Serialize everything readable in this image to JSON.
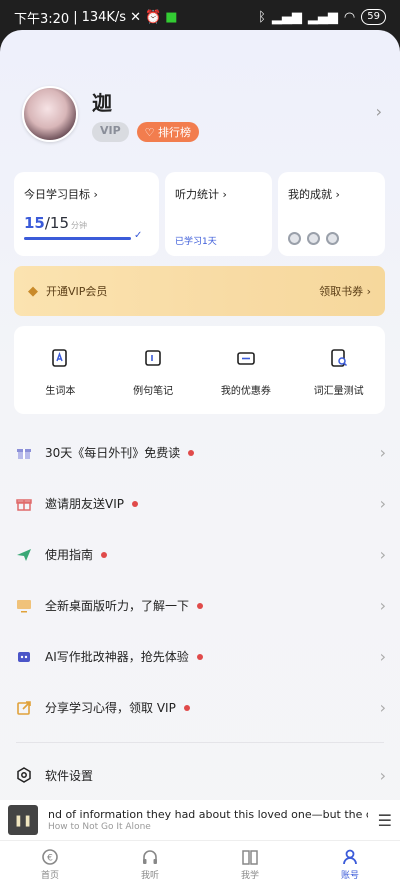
{
  "status_bar": {
    "time": "下午3:20",
    "speed": "134K/s",
    "battery": "59"
  },
  "profile": {
    "username": "迦",
    "vip_badge": "VIP",
    "rank_badge": "排行榜"
  },
  "cards": {
    "goal": {
      "title": "今日学习目标",
      "done": "15",
      "total": "/15",
      "unit": "分钟",
      "progress": 1.0
    },
    "listening": {
      "title": "听力统计",
      "learned": "已学习1天"
    },
    "achievement": {
      "title": "我的成就"
    }
  },
  "vip_banner": {
    "label": "开通VIP会员",
    "action": "领取书券"
  },
  "quick_actions": [
    {
      "label": "生词本",
      "icon": "vocabulary-book-icon"
    },
    {
      "label": "例句笔记",
      "icon": "notes-icon"
    },
    {
      "label": "我的优惠券",
      "icon": "coupon-icon"
    },
    {
      "label": "词汇量测试",
      "icon": "vocab-test-icon"
    }
  ],
  "menu": [
    {
      "label": "30天《每日外刊》免费读",
      "icon": "gift-icon",
      "color": "#8b8fd8"
    },
    {
      "label": "邀请朋友送VIP",
      "icon": "present-icon",
      "color": "#e06a6a"
    },
    {
      "label": "使用指南",
      "icon": "paper-plane-icon",
      "color": "#3aa876"
    },
    {
      "label": "全新桌面版听力，了解一下",
      "icon": "desktop-icon",
      "color": "#e0a23a"
    },
    {
      "label": "AI写作批改神器，抢先体验",
      "icon": "robot-icon",
      "color": "#4b55c8"
    },
    {
      "label": "分享学习心得，领取 VIP",
      "icon": "share-icon",
      "color": "#e0a23a"
    }
  ],
  "settings": {
    "label": "软件设置"
  },
  "player": {
    "line1": "nd of information they had about this loved one—but the c",
    "line2": "How to Not Go It Alone"
  },
  "tabs": [
    {
      "label": "首页",
      "icon": "home-icon"
    },
    {
      "label": "我听",
      "icon": "headphones-icon"
    },
    {
      "label": "我学",
      "icon": "book-icon"
    },
    {
      "label": "账号",
      "icon": "account-icon"
    }
  ],
  "colors": {
    "accent": "#3b5bd9",
    "rank": "#f27d4e",
    "dot": "#e04a4a"
  }
}
